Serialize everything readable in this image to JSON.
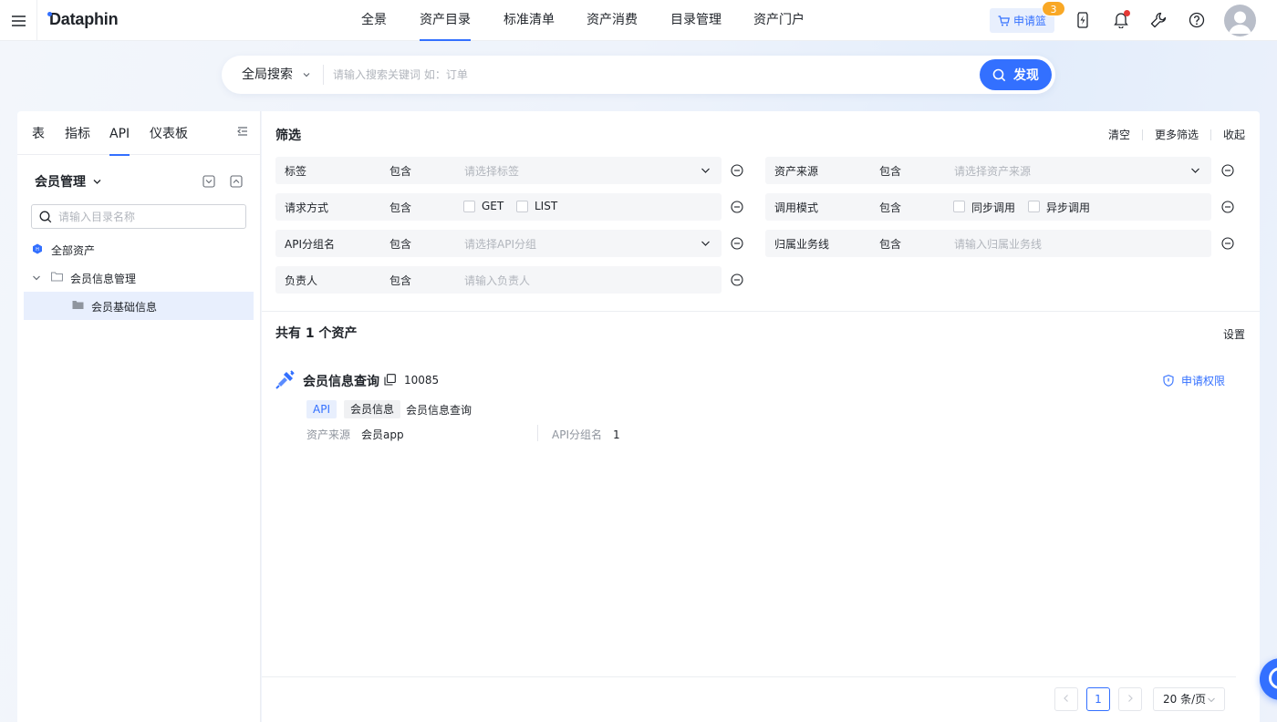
{
  "app": {
    "logo": "Dataphin"
  },
  "nav": {
    "items": [
      {
        "label": "全景"
      },
      {
        "label": "资产目录"
      },
      {
        "label": "标准清单"
      },
      {
        "label": "资产消费"
      },
      {
        "label": "目录管理"
      },
      {
        "label": "资产门户"
      }
    ],
    "active_index": 1
  },
  "header": {
    "cart_label": "申请篮",
    "cart_count": "3"
  },
  "search": {
    "scope": "全局搜索",
    "placeholder": "请输入搜索关键词 如：订单",
    "button_label": "发现"
  },
  "left": {
    "tabs": [
      "表",
      "指标",
      "API",
      "仪表板"
    ],
    "active_tab": 2,
    "catalog_title": "会员管理",
    "tree_search_placeholder": "请输入目录名称",
    "tree": [
      {
        "label": "全部资产"
      },
      {
        "label": "会员信息管理"
      },
      {
        "label": "会员基础信息"
      }
    ]
  },
  "filter": {
    "title": "筛选",
    "actions": [
      "清空",
      "更多筛选",
      "收起"
    ],
    "rows": [
      {
        "name": "标签",
        "op": "包含",
        "placeholder": "请选择标签"
      },
      {
        "name": "资产来源",
        "op": "包含",
        "placeholder": "请选择资产来源"
      },
      {
        "name": "请求方式",
        "op": "包含",
        "options": [
          "GET",
          "LIST"
        ]
      },
      {
        "name": "调用模式",
        "op": "包含",
        "options": [
          "同步调用",
          "异步调用"
        ]
      },
      {
        "name": "API分组名",
        "op": "包含",
        "placeholder": "请选择API分组"
      },
      {
        "name": "归属业务线",
        "op": "包含",
        "placeholder": "请输入归属业务线"
      },
      {
        "name": "负责人",
        "op": "包含",
        "placeholder": "请输入负责人"
      }
    ]
  },
  "results": {
    "count_text": "共有 1 个资产",
    "settings_label": "设置",
    "items": [
      {
        "name": "会员信息查询",
        "id": "10085",
        "action": "申请权限",
        "tags": [
          "API",
          "会员信息"
        ],
        "description": "会员信息查询",
        "meta": [
          {
            "key": "资产来源",
            "value": "会员app"
          },
          {
            "key": "API分组名",
            "value": "1"
          }
        ]
      }
    ]
  },
  "pagination": {
    "current": "1",
    "page_size": "20 条/页"
  },
  "colors": {
    "primary": "#3370ff",
    "badge": "#f9a825",
    "notify": "#e53935"
  }
}
